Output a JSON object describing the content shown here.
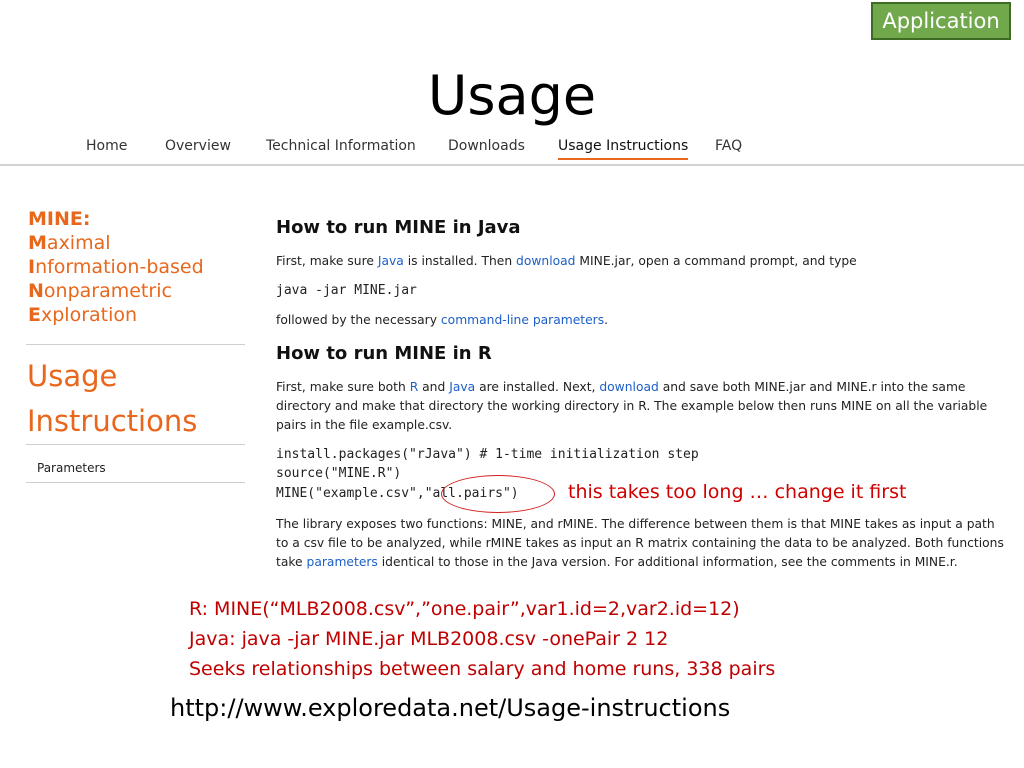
{
  "badge": "Application",
  "title": "Usage",
  "nav": {
    "home": "Home",
    "overview": "Overview",
    "technical": "Technical Information",
    "downloads": "Downloads",
    "usage": "Usage Instructions",
    "faq": "FAQ"
  },
  "sidebar": {
    "title": "MINE:",
    "acronym": [
      {
        "letter": "M",
        "rest": "aximal"
      },
      {
        "letter": "I",
        "rest": "nformation-based"
      },
      {
        "letter": "N",
        "rest": "onparametric"
      },
      {
        "letter": "E",
        "rest": "xploration"
      }
    ],
    "usage_line1": "Usage",
    "usage_line2": "Instructions",
    "parameters": "Parameters"
  },
  "java": {
    "heading": "How to run MINE in Java",
    "p1_a": "First, make sure ",
    "p1_link1": "Java",
    "p1_b": " is installed. Then ",
    "p1_link2": "download",
    "p1_c": " MINE.jar, open a command prompt, and type",
    "code": "java -jar MINE.jar",
    "p2_a": "followed by the necessary ",
    "p2_link": "command-line parameters",
    "p2_b": "."
  },
  "r": {
    "heading": "How to run MINE in R",
    "p1_a": "First, make sure both ",
    "p1_link1": "R",
    "p1_b": " and ",
    "p1_link2": "Java",
    "p1_c": " are installed. Next, ",
    "p1_link3": "download",
    "p1_d": " and save both MINE.jar and MINE.r into the same directory and make that directory the working directory in R. The example below then runs MINE on all the variable pairs in the file example.csv.",
    "code1": "install.packages(\"rJava\") # 1-time initialization step",
    "code2": "source(\"MINE.R\")",
    "code3": "MINE(\"example.csv\",\"all.pairs\")",
    "p2_a": "The library exposes two functions: MINE, and rMINE. The difference between them is that MINE takes as input a path to a csv file to be analyzed, while rMINE takes as input an R matrix containing the data to be analyzed. Both functions take ",
    "p2_link": "parameters",
    "p2_b": " identical to those in the Java version. For additional information, see the comments in MINE.r."
  },
  "annotation": "this takes too long … change it first",
  "notes": [
    "R: MINE(“MLB2008.csv”,”one.pair”,var1.id=2,var2.id=12)",
    "Java: java -jar MINE.jar MLB2008.csv -onePair 2 12",
    "Seeks relationships between salary and home runs, 338 pairs"
  ],
  "url": "http://www.exploredata.net/Usage-instructions",
  "colors": {
    "accent": "#e8671c",
    "link": "#1c5fc7",
    "note_red": "#c00000",
    "badge_green": "#71a84b"
  }
}
